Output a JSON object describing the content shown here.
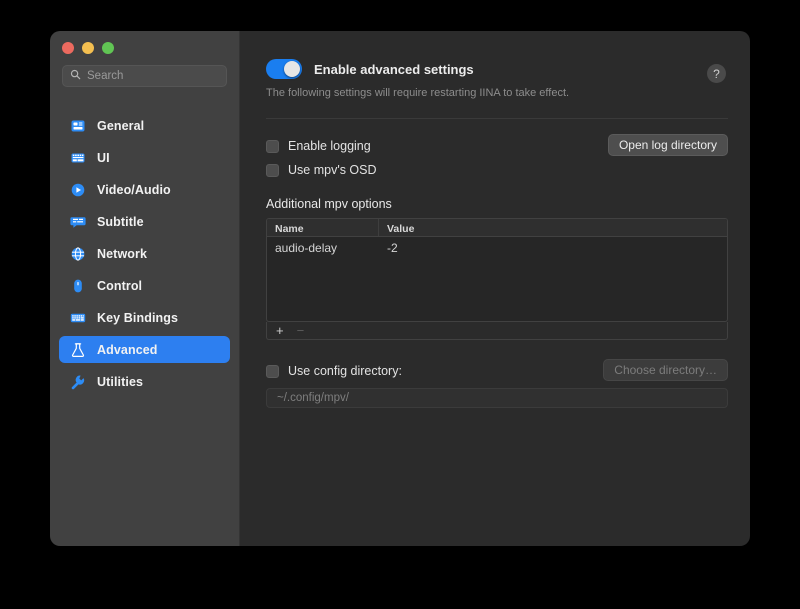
{
  "window": {
    "traffic_lights": [
      {
        "name": "close",
        "color": "#ec6a5f"
      },
      {
        "name": "minimize",
        "color": "#f4bf50"
      },
      {
        "name": "zoom",
        "color": "#61c554"
      }
    ]
  },
  "sidebar": {
    "search": {
      "value": "",
      "placeholder": "Search"
    },
    "items": [
      {
        "label": "General",
        "icon": "general-icon",
        "selected": false
      },
      {
        "label": "UI",
        "icon": "ui-icon",
        "selected": false
      },
      {
        "label": "Video/Audio",
        "icon": "video-audio-icon",
        "selected": false
      },
      {
        "label": "Subtitle",
        "icon": "subtitle-icon",
        "selected": false
      },
      {
        "label": "Network",
        "icon": "network-icon",
        "selected": false
      },
      {
        "label": "Control",
        "icon": "control-icon",
        "selected": false
      },
      {
        "label": "Key Bindings",
        "icon": "key-bindings-icon",
        "selected": false
      },
      {
        "label": "Advanced",
        "icon": "flask-icon",
        "selected": true
      },
      {
        "label": "Utilities",
        "icon": "wrench-icon",
        "selected": false
      }
    ],
    "accent_color": "#2d7ff0"
  },
  "main": {
    "advanced_toggle": {
      "label": "Enable advanced settings",
      "state": "on",
      "on_color": "#1a7ef0"
    },
    "help_button": {
      "glyph": "?"
    },
    "note": "The following settings will require restarting IINA to take effect.",
    "checkboxes": [
      {
        "label": "Enable logging",
        "checked": false
      },
      {
        "label": "Use mpv's OSD",
        "checked": false
      }
    ],
    "open_log_button": {
      "label": "Open log directory",
      "enabled": true
    },
    "mpv_options": {
      "title": "Additional mpv options",
      "columns": [
        "Name",
        "Value"
      ],
      "rows": [
        {
          "name": "audio-delay",
          "value": "-2"
        }
      ],
      "add_button": "+",
      "remove_button": "−"
    },
    "config_directory": {
      "checkbox_label": "Use config directory:",
      "checked": false,
      "choose_button": {
        "label": "Choose directory…",
        "enabled": false
      },
      "path": "~/.config/mpv/"
    }
  }
}
